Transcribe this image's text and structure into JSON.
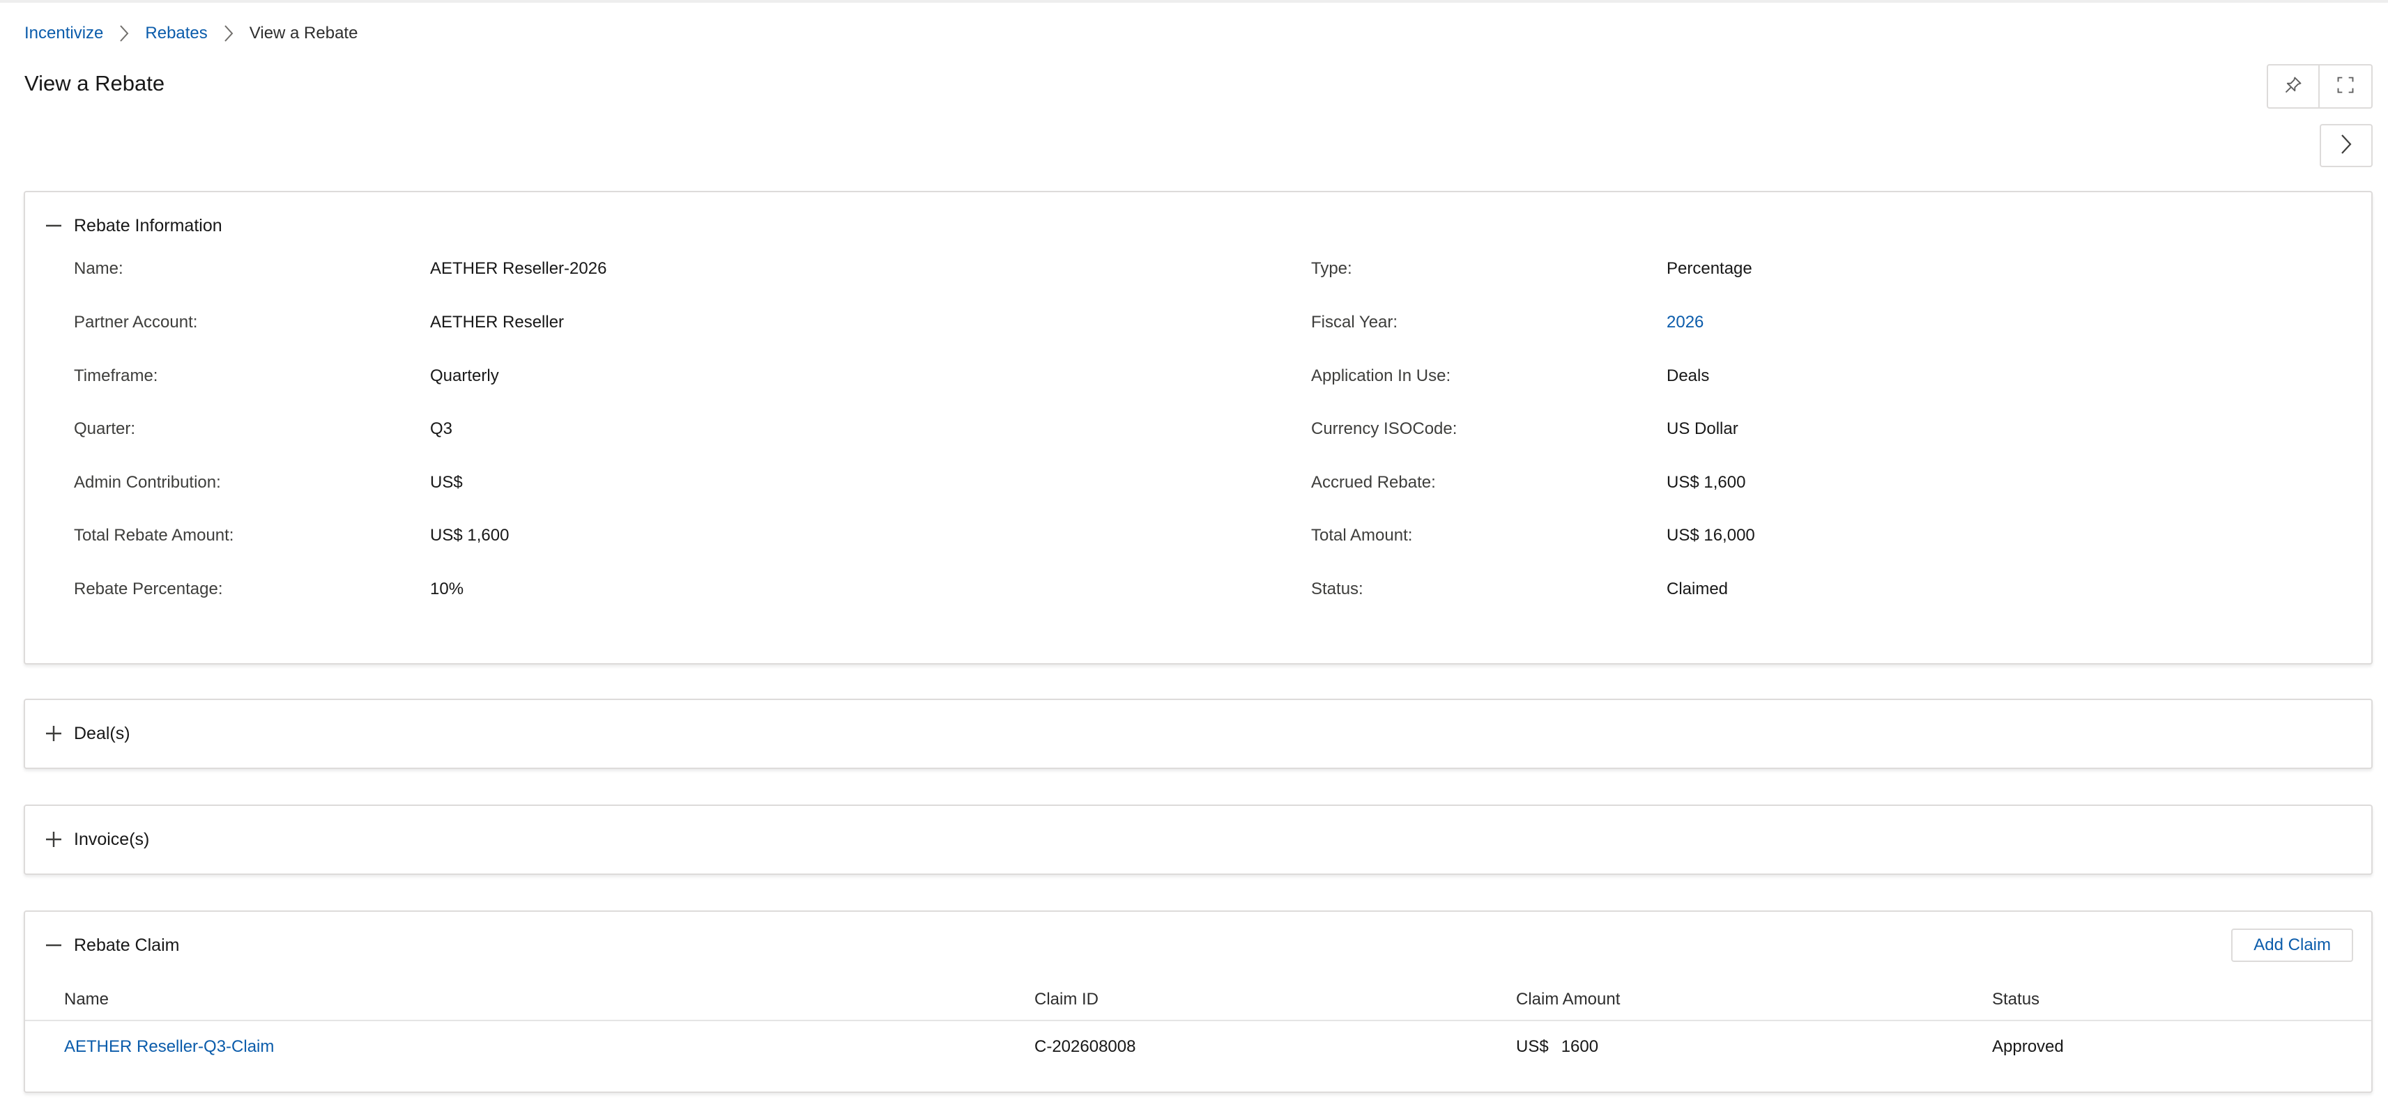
{
  "breadcrumb": [
    {
      "label": "Incentivize"
    },
    {
      "label": "Rebates"
    },
    {
      "label": "View a Rebate"
    }
  ],
  "page": {
    "title": "View a Rebate"
  },
  "icons": {
    "pin": "pin-icon",
    "expand": "expand-icon",
    "next": "chevron-right-icon",
    "collapse": "minus-icon",
    "expand_section": "plus-icon"
  },
  "colors": {
    "link": "#0b5cab",
    "border": "#dddbda",
    "text": "#181818"
  },
  "rebate_info": {
    "title": "Rebate Information",
    "left": [
      {
        "label": "Name:",
        "value": "AETHER Reseller-2026"
      },
      {
        "label": "Partner Account:",
        "value": "AETHER Reseller"
      },
      {
        "label": "Timeframe:",
        "value": "Quarterly"
      },
      {
        "label": "Quarter:",
        "value": "Q3"
      },
      {
        "label": "Admin Contribution:",
        "value": "US$"
      },
      {
        "label": "Total Rebate Amount:",
        "value": "US$ 1,600"
      },
      {
        "label": "Rebate Percentage:",
        "value": "10%"
      }
    ],
    "right": [
      {
        "label": "Type:",
        "value": "Percentage"
      },
      {
        "label": "Fiscal Year:",
        "value": "2026"
      },
      {
        "label": "Application In Use:",
        "value": "Deals"
      },
      {
        "label": "Currency ISOCode:",
        "value": "US Dollar"
      },
      {
        "label": "Accrued Rebate:",
        "value": "US$ 1,600"
      },
      {
        "label": "Total Amount:",
        "value": "US$ 16,000"
      },
      {
        "label": "Status:",
        "value": "Claimed"
      }
    ]
  },
  "deals": {
    "title": "Deal(s)"
  },
  "invoices": {
    "title": "Invoice(s)"
  },
  "rebate_claim": {
    "title": "Rebate Claim",
    "add_label": "Add Claim",
    "columns": [
      "Name",
      "Claim ID",
      "Claim Amount",
      "Status"
    ],
    "rows": [
      {
        "name": "AETHER Reseller-Q3-Claim",
        "claim_id": "C-202608008",
        "currency": "US$",
        "amount": "1600",
        "status": "Approved"
      }
    ]
  }
}
